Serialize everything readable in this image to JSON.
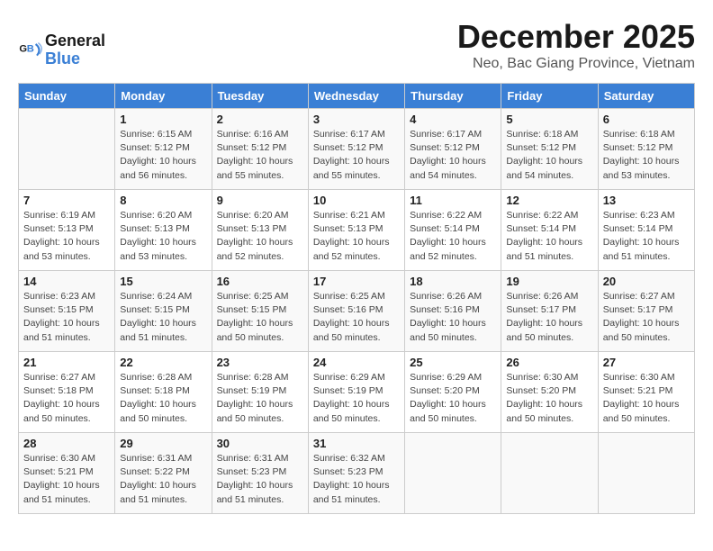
{
  "logo": {
    "line1": "General",
    "line2": "Blue"
  },
  "header": {
    "month": "December 2025",
    "location": "Neo, Bac Giang Province, Vietnam"
  },
  "days_of_week": [
    "Sunday",
    "Monday",
    "Tuesday",
    "Wednesday",
    "Thursday",
    "Friday",
    "Saturday"
  ],
  "weeks": [
    [
      {
        "day": "",
        "sunrise": "",
        "sunset": "",
        "daylight": ""
      },
      {
        "day": "1",
        "sunrise": "Sunrise: 6:15 AM",
        "sunset": "Sunset: 5:12 PM",
        "daylight": "Daylight: 10 hours and 56 minutes."
      },
      {
        "day": "2",
        "sunrise": "Sunrise: 6:16 AM",
        "sunset": "Sunset: 5:12 PM",
        "daylight": "Daylight: 10 hours and 55 minutes."
      },
      {
        "day": "3",
        "sunrise": "Sunrise: 6:17 AM",
        "sunset": "Sunset: 5:12 PM",
        "daylight": "Daylight: 10 hours and 55 minutes."
      },
      {
        "day": "4",
        "sunrise": "Sunrise: 6:17 AM",
        "sunset": "Sunset: 5:12 PM",
        "daylight": "Daylight: 10 hours and 54 minutes."
      },
      {
        "day": "5",
        "sunrise": "Sunrise: 6:18 AM",
        "sunset": "Sunset: 5:12 PM",
        "daylight": "Daylight: 10 hours and 54 minutes."
      },
      {
        "day": "6",
        "sunrise": "Sunrise: 6:18 AM",
        "sunset": "Sunset: 5:12 PM",
        "daylight": "Daylight: 10 hours and 53 minutes."
      }
    ],
    [
      {
        "day": "7",
        "sunrise": "Sunrise: 6:19 AM",
        "sunset": "Sunset: 5:13 PM",
        "daylight": "Daylight: 10 hours and 53 minutes."
      },
      {
        "day": "8",
        "sunrise": "Sunrise: 6:20 AM",
        "sunset": "Sunset: 5:13 PM",
        "daylight": "Daylight: 10 hours and 53 minutes."
      },
      {
        "day": "9",
        "sunrise": "Sunrise: 6:20 AM",
        "sunset": "Sunset: 5:13 PM",
        "daylight": "Daylight: 10 hours and 52 minutes."
      },
      {
        "day": "10",
        "sunrise": "Sunrise: 6:21 AM",
        "sunset": "Sunset: 5:13 PM",
        "daylight": "Daylight: 10 hours and 52 minutes."
      },
      {
        "day": "11",
        "sunrise": "Sunrise: 6:22 AM",
        "sunset": "Sunset: 5:14 PM",
        "daylight": "Daylight: 10 hours and 52 minutes."
      },
      {
        "day": "12",
        "sunrise": "Sunrise: 6:22 AM",
        "sunset": "Sunset: 5:14 PM",
        "daylight": "Daylight: 10 hours and 51 minutes."
      },
      {
        "day": "13",
        "sunrise": "Sunrise: 6:23 AM",
        "sunset": "Sunset: 5:14 PM",
        "daylight": "Daylight: 10 hours and 51 minutes."
      }
    ],
    [
      {
        "day": "14",
        "sunrise": "Sunrise: 6:23 AM",
        "sunset": "Sunset: 5:15 PM",
        "daylight": "Daylight: 10 hours and 51 minutes."
      },
      {
        "day": "15",
        "sunrise": "Sunrise: 6:24 AM",
        "sunset": "Sunset: 5:15 PM",
        "daylight": "Daylight: 10 hours and 51 minutes."
      },
      {
        "day": "16",
        "sunrise": "Sunrise: 6:25 AM",
        "sunset": "Sunset: 5:15 PM",
        "daylight": "Daylight: 10 hours and 50 minutes."
      },
      {
        "day": "17",
        "sunrise": "Sunrise: 6:25 AM",
        "sunset": "Sunset: 5:16 PM",
        "daylight": "Daylight: 10 hours and 50 minutes."
      },
      {
        "day": "18",
        "sunrise": "Sunrise: 6:26 AM",
        "sunset": "Sunset: 5:16 PM",
        "daylight": "Daylight: 10 hours and 50 minutes."
      },
      {
        "day": "19",
        "sunrise": "Sunrise: 6:26 AM",
        "sunset": "Sunset: 5:17 PM",
        "daylight": "Daylight: 10 hours and 50 minutes."
      },
      {
        "day": "20",
        "sunrise": "Sunrise: 6:27 AM",
        "sunset": "Sunset: 5:17 PM",
        "daylight": "Daylight: 10 hours and 50 minutes."
      }
    ],
    [
      {
        "day": "21",
        "sunrise": "Sunrise: 6:27 AM",
        "sunset": "Sunset: 5:18 PM",
        "daylight": "Daylight: 10 hours and 50 minutes."
      },
      {
        "day": "22",
        "sunrise": "Sunrise: 6:28 AM",
        "sunset": "Sunset: 5:18 PM",
        "daylight": "Daylight: 10 hours and 50 minutes."
      },
      {
        "day": "23",
        "sunrise": "Sunrise: 6:28 AM",
        "sunset": "Sunset: 5:19 PM",
        "daylight": "Daylight: 10 hours and 50 minutes."
      },
      {
        "day": "24",
        "sunrise": "Sunrise: 6:29 AM",
        "sunset": "Sunset: 5:19 PM",
        "daylight": "Daylight: 10 hours and 50 minutes."
      },
      {
        "day": "25",
        "sunrise": "Sunrise: 6:29 AM",
        "sunset": "Sunset: 5:20 PM",
        "daylight": "Daylight: 10 hours and 50 minutes."
      },
      {
        "day": "26",
        "sunrise": "Sunrise: 6:30 AM",
        "sunset": "Sunset: 5:20 PM",
        "daylight": "Daylight: 10 hours and 50 minutes."
      },
      {
        "day": "27",
        "sunrise": "Sunrise: 6:30 AM",
        "sunset": "Sunset: 5:21 PM",
        "daylight": "Daylight: 10 hours and 50 minutes."
      }
    ],
    [
      {
        "day": "28",
        "sunrise": "Sunrise: 6:30 AM",
        "sunset": "Sunset: 5:21 PM",
        "daylight": "Daylight: 10 hours and 51 minutes."
      },
      {
        "day": "29",
        "sunrise": "Sunrise: 6:31 AM",
        "sunset": "Sunset: 5:22 PM",
        "daylight": "Daylight: 10 hours and 51 minutes."
      },
      {
        "day": "30",
        "sunrise": "Sunrise: 6:31 AM",
        "sunset": "Sunset: 5:23 PM",
        "daylight": "Daylight: 10 hours and 51 minutes."
      },
      {
        "day": "31",
        "sunrise": "Sunrise: 6:32 AM",
        "sunset": "Sunset: 5:23 PM",
        "daylight": "Daylight: 10 hours and 51 minutes."
      },
      {
        "day": "",
        "sunrise": "",
        "sunset": "",
        "daylight": ""
      },
      {
        "day": "",
        "sunrise": "",
        "sunset": "",
        "daylight": ""
      },
      {
        "day": "",
        "sunrise": "",
        "sunset": "",
        "daylight": ""
      }
    ]
  ]
}
